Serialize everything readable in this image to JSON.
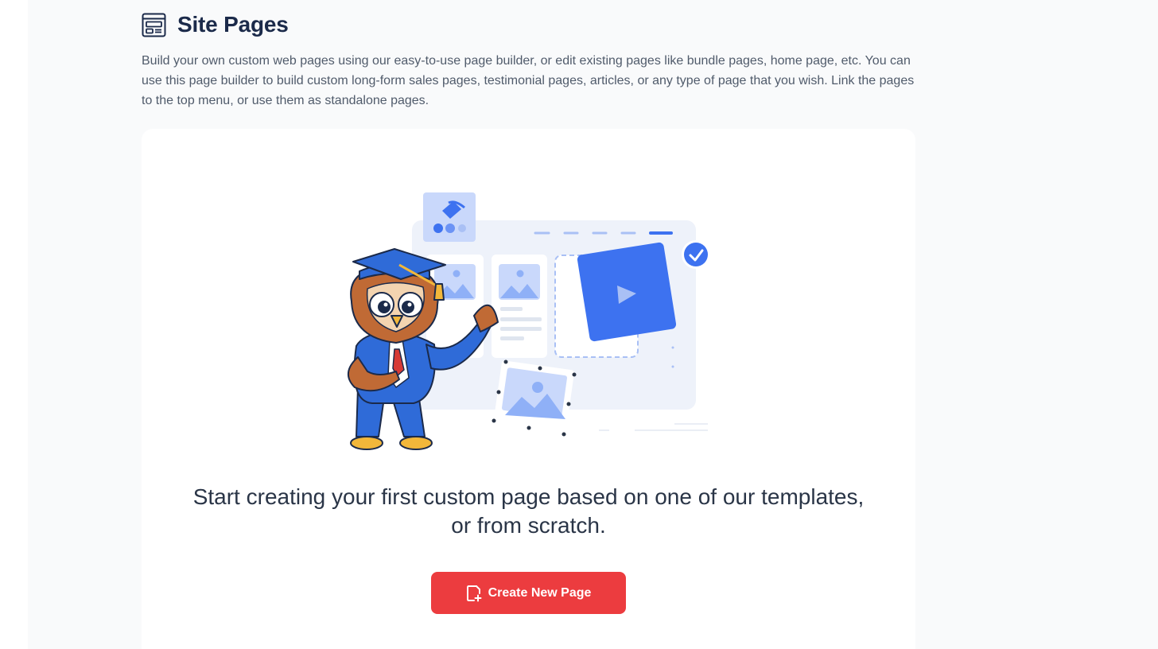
{
  "header": {
    "title": "Site Pages",
    "icon": "page-layout-icon"
  },
  "description": "Build your own custom web pages using our easy-to-use page builder, or edit existing pages like bundle pages, home page, etc. You can use this page builder to build custom long-form sales pages, testimonial pages, articles, or any type of page that you wish. Link the pages to the top menu, or use them as standalone pages.",
  "empty_state": {
    "illustration": "owl-mascot-page-builder-illustration",
    "message": "Start creating your first custom page based on one of our templates, or from scratch.",
    "button_label": "Create New Page",
    "button_icon": "new-page-icon"
  },
  "colors": {
    "accent": "#ec3c3f",
    "brand_blue": "#3d72f0",
    "title": "#1b2a4a",
    "background": "#f9fafb"
  }
}
